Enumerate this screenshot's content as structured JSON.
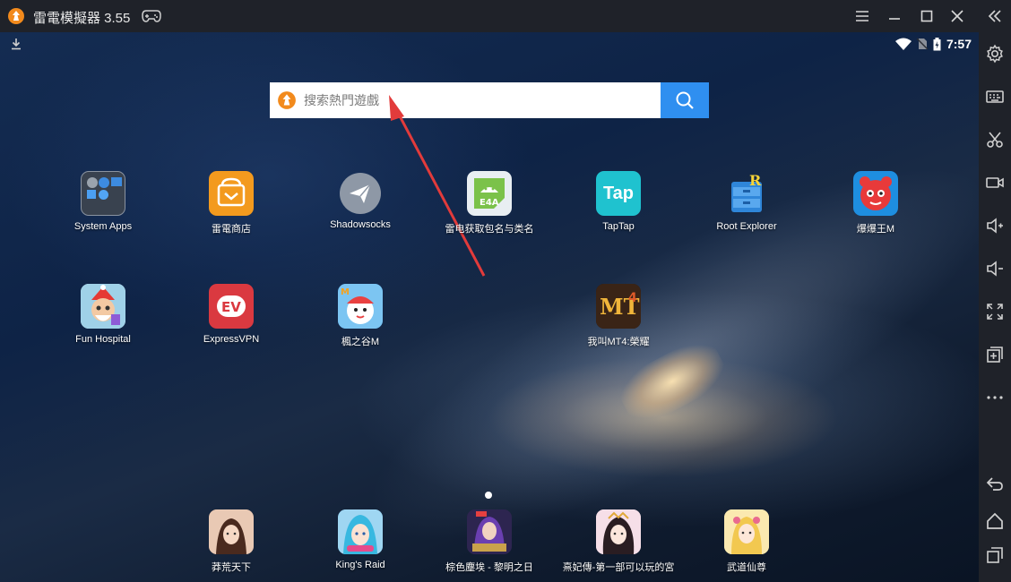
{
  "window": {
    "title": "雷電模擬器 3.55"
  },
  "status_bar": {
    "time": "7:57"
  },
  "search": {
    "placeholder": "搜索熱門遊戲"
  },
  "apps": [
    {
      "label": "System Apps",
      "icon": "folder-icon"
    },
    {
      "label": "雷電商店",
      "icon": "store-icon"
    },
    {
      "label": "Shadowsocks",
      "icon": "paper-plane-icon"
    },
    {
      "label": "雷电获取包名与类名",
      "icon": "android-icon"
    },
    {
      "label": "TapTap",
      "icon": "taptap-icon"
    },
    {
      "label": "Root Explorer",
      "icon": "root-explorer-icon"
    },
    {
      "label": "爆爆王M",
      "icon": "game-icon"
    },
    {
      "label": "Fun Hospital",
      "icon": "game-icon"
    },
    {
      "label": "ExpressVPN",
      "icon": "expressvpn-icon"
    },
    {
      "label": "楓之谷M",
      "icon": "game-icon"
    },
    {
      "label": "我叫MT4:榮耀",
      "icon": "game-icon"
    }
  ],
  "dock": [
    {
      "label": "莽荒天下",
      "icon": "game-icon"
    },
    {
      "label": "King's Raid",
      "icon": "game-icon"
    },
    {
      "label": "棕色塵埃 - 黎明之日",
      "icon": "game-icon"
    },
    {
      "label": "熹妃傳-第一部可以玩的宮",
      "icon": "game-icon"
    },
    {
      "label": "武道仙尊",
      "icon": "game-icon"
    }
  ],
  "colors": {
    "titlebar": "#1f2229",
    "search_button": "#2f8ff0",
    "brand_orange": "#f28a1c",
    "annotation_arrow": "#e23b3b"
  }
}
